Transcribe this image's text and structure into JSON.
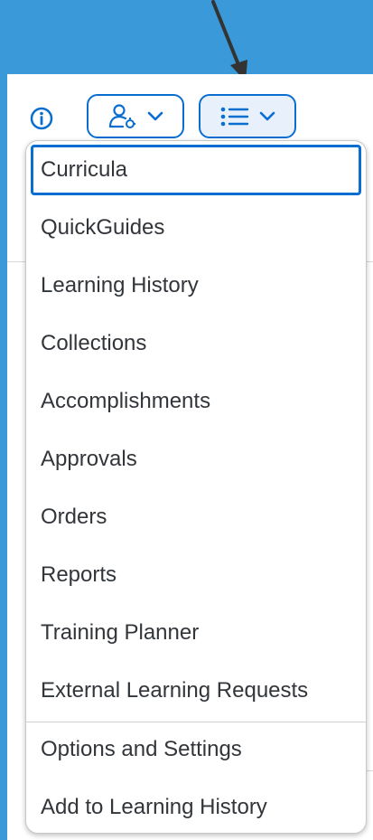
{
  "header": {
    "info_icon": "info-icon",
    "profile_button_icon": "user-settings-icon",
    "menu_button_icon": "list-menu-icon",
    "chevron_icon": "chevron-down-icon"
  },
  "menu": {
    "items": [
      {
        "label": "Curricula",
        "selected": true
      },
      {
        "label": "QuickGuides"
      },
      {
        "label": "Learning History"
      },
      {
        "label": "Collections"
      },
      {
        "label": "Accomplishments"
      },
      {
        "label": "Approvals"
      },
      {
        "label": "Orders"
      },
      {
        "label": "Reports"
      },
      {
        "label": "Training Planner"
      },
      {
        "label": "External Learning Requests"
      },
      {
        "label": "Options and Settings"
      },
      {
        "label": "Add to Learning History"
      }
    ]
  },
  "colors": {
    "background": "#3a9ad9",
    "accent": "#0a6ed1",
    "text": "#32363a",
    "arrow": "#333333"
  }
}
